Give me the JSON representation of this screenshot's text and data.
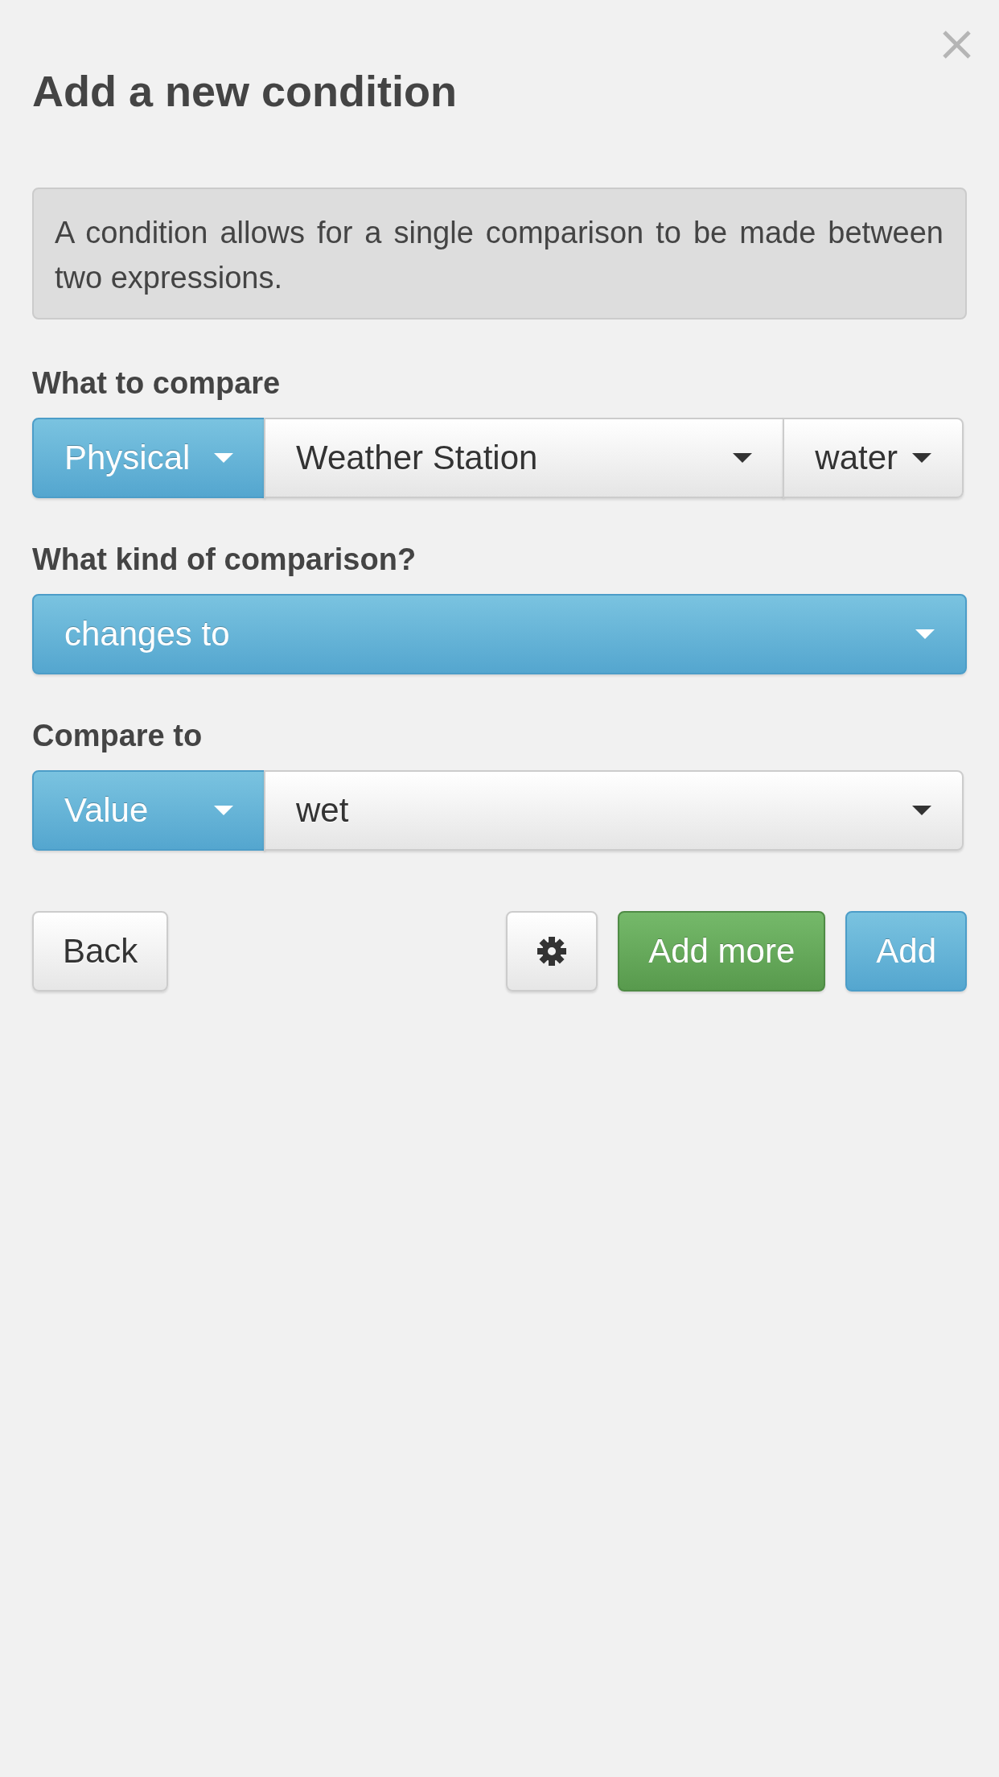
{
  "dialog": {
    "title": "Add a new condition",
    "info": "A condition allows for a single comparison to be made between two expressions."
  },
  "sections": [
    {
      "label": "What to compare",
      "selects": [
        {
          "kind": "primary",
          "value": "Physical"
        },
        {
          "kind": "default",
          "value": "Weather Station"
        },
        {
          "kind": "default",
          "value": "water"
        }
      ]
    },
    {
      "label": "What kind of comparison?",
      "selects": [
        {
          "kind": "primary",
          "value": "changes to"
        }
      ]
    },
    {
      "label": "Compare to",
      "selects": [
        {
          "kind": "primary",
          "value": "Value"
        },
        {
          "kind": "default",
          "value": "wet"
        }
      ]
    }
  ],
  "actions": {
    "left": [
      {
        "kind": "default",
        "label": "Back"
      }
    ],
    "right": [
      {
        "kind": "settings"
      },
      {
        "kind": "success",
        "label": "Add more"
      },
      {
        "kind": "primary",
        "label": "Add"
      }
    ]
  }
}
